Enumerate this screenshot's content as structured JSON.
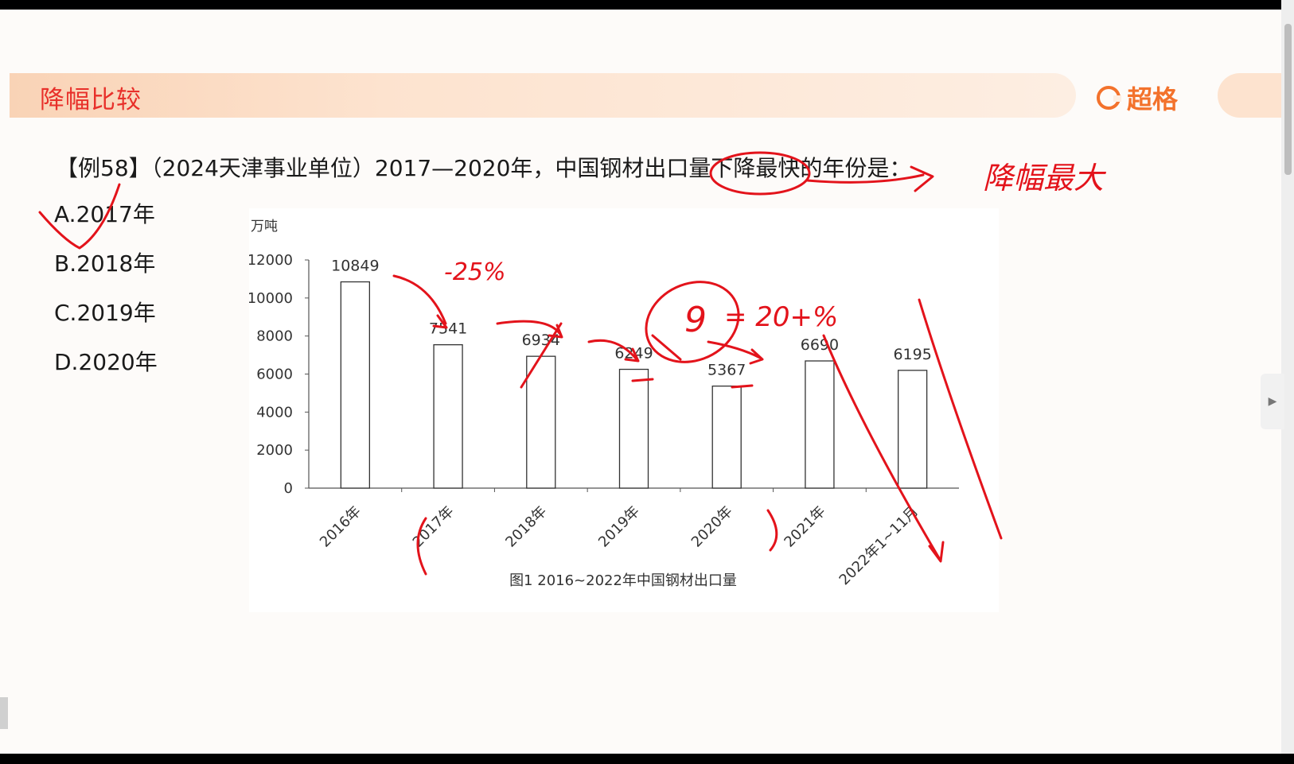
{
  "slide": {
    "section_title": "降幅比较",
    "logo_text": "超格",
    "question": "【例58】（2024天津事业单位）2017—2020年，中国钢材出口量下降最快的年份是：",
    "options": [
      {
        "label": "A.2017年"
      },
      {
        "label": "B.2018年"
      },
      {
        "label": "C.2019年"
      },
      {
        "label": "D.2020年"
      }
    ],
    "handwriting": {
      "note_right": "降幅最大",
      "note_pct1": "-25%",
      "note_pct2": "= 20+%",
      "note_nine": "9"
    },
    "colors": {
      "accent": "#e8302a",
      "brand": "#f3722c",
      "ink": "#e3131b",
      "bar_fill": "#ffffff",
      "bar_stroke": "#333333"
    }
  },
  "chart_data": {
    "type": "bar",
    "unit_label": "万吨",
    "categories": [
      "2016年",
      "2017年",
      "2018年",
      "2019年",
      "2020年",
      "2021年",
      "2022年1~11月"
    ],
    "values": [
      10849,
      7541,
      6934,
      6249,
      5367,
      6690,
      6195
    ],
    "value_labels": [
      "10849",
      "7541",
      "6934",
      "6249",
      "5367",
      "6690",
      "6195"
    ],
    "yticks": [
      0,
      2000,
      4000,
      6000,
      8000,
      10000,
      12000
    ],
    "ylim": [
      0,
      12000
    ],
    "caption": "图1 2016~2022年中国钢材出口量",
    "grid": false
  }
}
